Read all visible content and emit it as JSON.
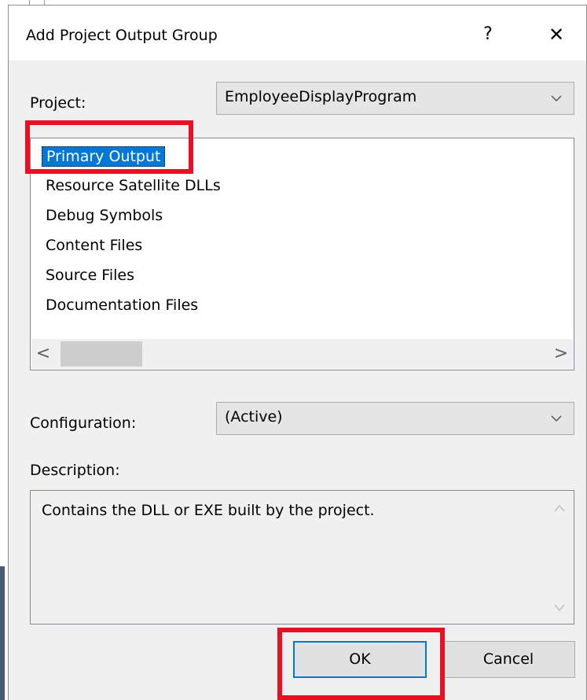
{
  "dialog": {
    "title": "Add Project Output Group",
    "help_label": "?",
    "close_label": "✕"
  },
  "project": {
    "label": "Project:",
    "value": "EmployeeDisplayProgram"
  },
  "output_list": {
    "items": [
      "Primary Output",
      "Resource Satellite DLLs",
      "Debug Symbols",
      "Content Files",
      "Source Files",
      "Documentation Files"
    ],
    "selected": "Primary Output",
    "scroll_left": "<",
    "scroll_right": ">"
  },
  "configuration": {
    "label": "Configuration:",
    "value": "(Active)"
  },
  "description": {
    "label": "Description:",
    "text": "Contains the DLL or EXE built by the project."
  },
  "buttons": {
    "ok": "OK",
    "cancel": "Cancel"
  },
  "colors": {
    "selection": "#0078d7",
    "highlight": "#e81123"
  }
}
